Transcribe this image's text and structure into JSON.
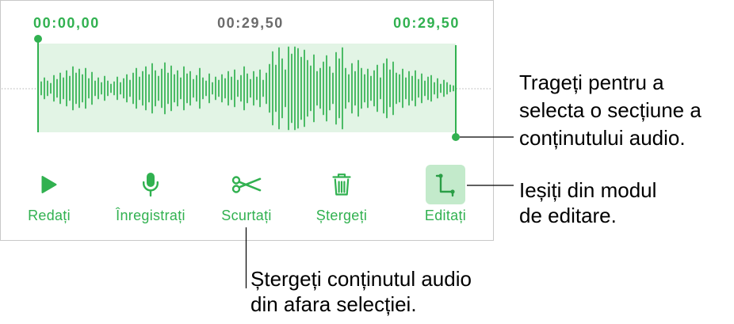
{
  "colors": {
    "accent": "#31B150",
    "selection_fill": "#E2F4E5",
    "active_button_background": "#C3EACB",
    "active_button_icon": "#2A9E46",
    "secondary_text": "#6B6B6B",
    "panel_border": "#C8C8C8"
  },
  "timeline": {
    "start_time": "00:00,00",
    "duration": "00:29,50",
    "end_time": "00:29,50"
  },
  "toolbar": {
    "buttons": [
      {
        "label": "Redați",
        "icon": "play-icon",
        "active": false
      },
      {
        "label": "Înregistrați",
        "icon": "microphone-icon",
        "active": false
      },
      {
        "label": "Scurtați",
        "icon": "scissors-icon",
        "active": false
      },
      {
        "label": "Ștergeți",
        "icon": "trash-icon",
        "active": false
      },
      {
        "label": "Editați",
        "icon": "crop-icon",
        "active": true
      }
    ]
  },
  "callouts": {
    "drag_selection": [
      "Trageți pentru a",
      "selecta o secțiune a",
      "conținutului audio."
    ],
    "exit_edit_mode": [
      "Ieșiți din modul",
      "de editare."
    ],
    "trim": [
      "Ștergeți conținutul audio",
      "din afara selecției."
    ]
  }
}
